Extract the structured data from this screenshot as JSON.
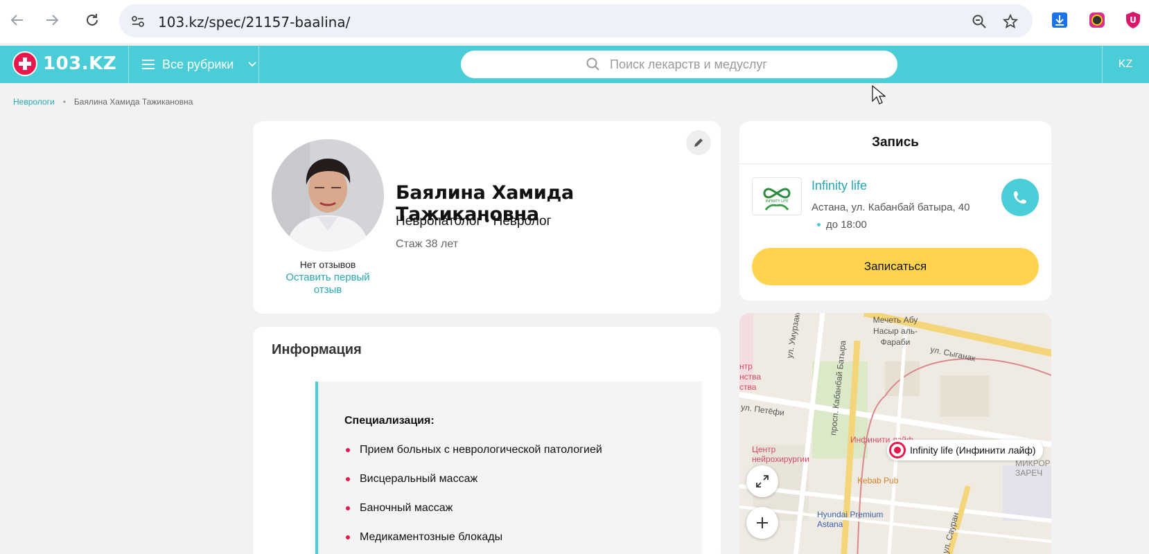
{
  "browser": {
    "url": "103.kz/spec/21157-baalina/"
  },
  "header": {
    "logo_text": "103.KZ",
    "rubrics_label": "Все рубрики",
    "search_placeholder": "Поиск лекарств и медуслуг",
    "lang": "KZ"
  },
  "breadcrumb": {
    "parent": "Неврологи",
    "separator": "•",
    "current": "Баялина Хамида Тажикановна"
  },
  "profile": {
    "name": "Баялина Хамида Тажикановна",
    "specialty": "Невропатолог • Невролог",
    "experience": "Стаж 38 лет",
    "no_reviews": "Нет отзывов",
    "leave_review": "Оставить первый отзыв"
  },
  "info": {
    "title": "Информация",
    "spec_title": "Специализация:",
    "items": [
      "Прием больных с неврологической патологией",
      "Висцеральный массаж",
      "Баночный массаж",
      "Медикаментозные блокады"
    ]
  },
  "booking": {
    "title": "Запись",
    "clinic_name": "Infinity life",
    "clinic_logo_text": "INFINITY LIFE",
    "address": "Астана, ул. Кабанбай батыра, 40",
    "hours": "до 18:00",
    "button": "Записаться"
  },
  "map": {
    "pin_label": "Infinity life (Инфинити лайф)",
    "labels": {
      "mosque": "Мечеть Абу Насыр аль-Фараби",
      "syganak": "ул. Сыганак",
      "umyrzakova": "ул. Умурзаковой",
      "kabanbai": "просп. Кабанбай Батыра",
      "petofi": "ул. Петёфи",
      "center": "Центр нейрохирургии",
      "infinity": "Инфинити лайф",
      "kebab": "Kebab Pub",
      "hyundai": "Hyundai Premium Astana",
      "sauran": "ул. Сауран",
      "micro": "МИКРОР ЗАРЕЧ",
      "left_edge": "нтр нства ства"
    }
  },
  "colors": {
    "brand": "#4acdd6",
    "accent_red": "#e8174b",
    "button_yellow": "#ffd34e",
    "link": "#26a8b4"
  }
}
